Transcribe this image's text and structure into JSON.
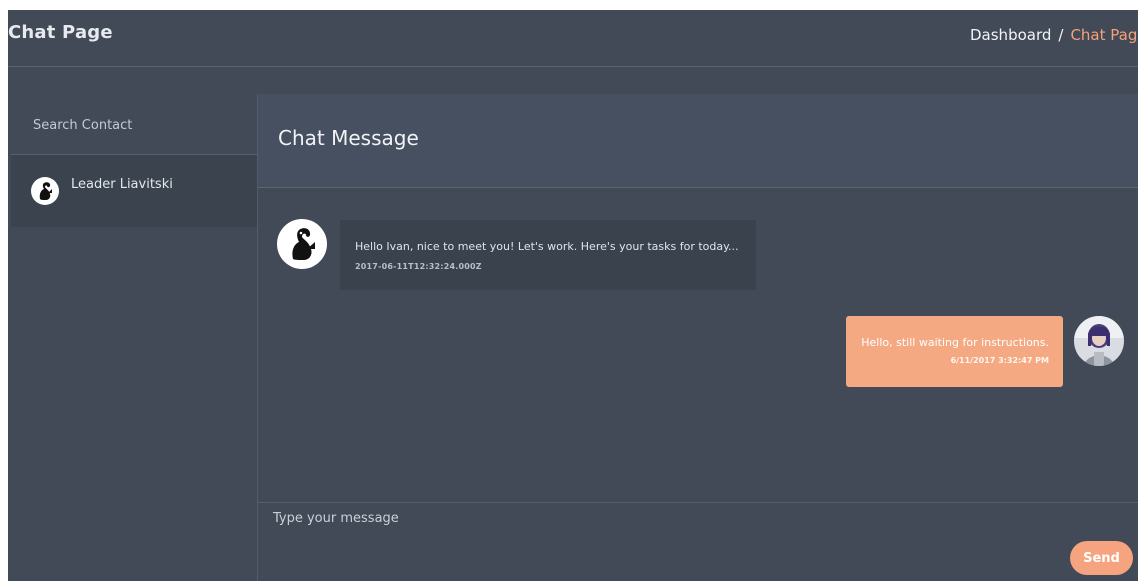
{
  "header": {
    "title": "Chat Page",
    "breadcrumb": {
      "dashboard_label": "Dashboard",
      "separator": "/",
      "current_label": "Chat Page"
    }
  },
  "sidebar": {
    "search_placeholder": "Search Contact",
    "contacts": [
      {
        "name": "Leader Liavitski",
        "avatar_icon": "cat-avatar-icon"
      }
    ]
  },
  "chat": {
    "title": "Chat Message",
    "messages": [
      {
        "direction": "incoming",
        "text": "Hello Ivan, nice to meet you! Let's work. Here's your tasks for today...",
        "timestamp": "2017-06-11T12:32:24.000Z",
        "avatar_icon": "cat-avatar-icon"
      },
      {
        "direction": "outgoing",
        "text": "Hello, still waiting for instructions.",
        "timestamp": "6/11/2017 3:32:47 PM",
        "avatar_icon": "user-photo-avatar"
      }
    ],
    "composer": {
      "placeholder": "Type your message",
      "send_label": "Send"
    }
  },
  "colors": {
    "background": "#414a56",
    "accent": "#f6a47f",
    "incoming_bubble": "#3a424d"
  }
}
